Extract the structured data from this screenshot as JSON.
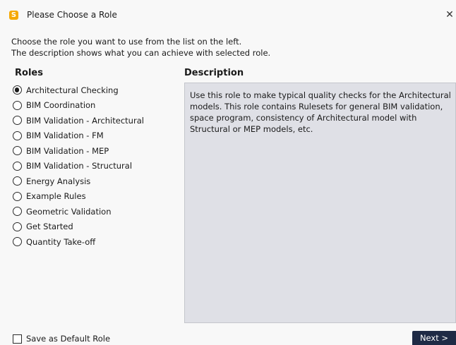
{
  "window": {
    "title": "Please Choose a Role",
    "app_icon_letter": "S",
    "close_glyph": "✕"
  },
  "intro": {
    "line1": "Choose the role you want to use from the list on the left.",
    "line2": "The description shows what you can achieve with selected role."
  },
  "roles": {
    "heading": "Roles",
    "selected_index": 0,
    "items": [
      {
        "label": "Architectural Checking"
      },
      {
        "label": "BIM Coordination"
      },
      {
        "label": "BIM Validation - Architectural"
      },
      {
        "label": "BIM Validation - FM"
      },
      {
        "label": "BIM Validation - MEP"
      },
      {
        "label": "BIM Validation - Structural"
      },
      {
        "label": "Energy Analysis"
      },
      {
        "label": "Example Rules"
      },
      {
        "label": "Geometric Validation"
      },
      {
        "label": "Get Started"
      },
      {
        "label": "Quantity Take-off"
      }
    ]
  },
  "description": {
    "heading": "Description",
    "lines": [
      "Use this role to make typical quality checks for the Architectural",
      "models. This role contains Rulesets for general BIM validation,",
      "space program, consistency of Architectural model with",
      "Structural or MEP models, etc."
    ]
  },
  "footer": {
    "save_default_label": "Save as Default Role",
    "save_default_checked": false,
    "next_label": "Next >"
  },
  "colors": {
    "app_icon": "#f5a800",
    "next_button": "#1e2a45",
    "description_bg": "#dfe0e6"
  }
}
